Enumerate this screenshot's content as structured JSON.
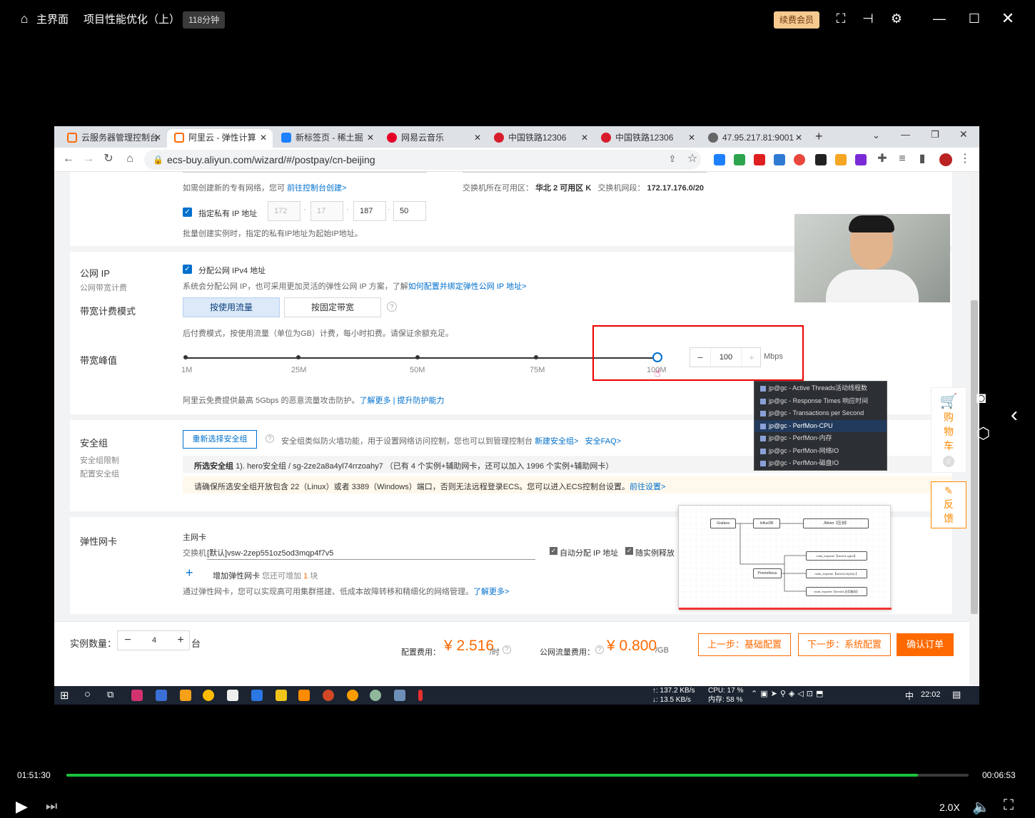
{
  "player": {
    "home_label": "主界面",
    "course_title": "项目性能优化（上）",
    "duration_badge": "118分钟",
    "vip_button": "续费会员",
    "time_elapsed": "01:51:30",
    "time_remaining": "00:06:53",
    "speed": "2.0X",
    "progress": 0.944
  },
  "browser": {
    "tabs": [
      {
        "title": "云服务器管理控制台",
        "color": "#ff6a00"
      },
      {
        "title": "阿里云 - 弹性计算",
        "color": "#ff6a00"
      },
      {
        "title": "新标签页 - 稀土掘",
        "color": "#1e80ff"
      },
      {
        "title": "网易云音乐",
        "color": "#e60026"
      },
      {
        "title": "中国铁路12306",
        "color": "#d71d2b"
      },
      {
        "title": "中国铁路12306",
        "color": "#d71d2b"
      },
      {
        "title": "47.95.217.81:9001",
        "color": "#666666"
      }
    ],
    "url": "ecs-buy.aliyun.com/wizard/#/postpay/cn-beijing"
  },
  "network": {
    "vpc_hint": "如需创建新的专有网络，您可",
    "vpc_hint_link": "前往控制台创建>",
    "zone_label": "交换机所在可用区：",
    "zone_value": "华北 2 可用区 K",
    "cidr_label": "交换机网段：",
    "cidr_value": "172.17.176.0/20",
    "private_ip_label": "指定私有 IP 地址",
    "ip_octets": [
      "172",
      "17",
      "187",
      "50"
    ],
    "private_ip_hint": "批量创建实例时，指定的私有IP地址为起始IP地址。"
  },
  "public_ip": {
    "title": "公网 IP",
    "subtitle": "公网带宽计费",
    "assign_label": "分配公网 IPv4 地址",
    "desc": "系统会分配公网 IP，也可采用更加灵活的弹性公网 IP 方案，了解",
    "desc_link": "如何配置并绑定弹性公网 IP 地址>",
    "billing_mode_label": "带宽计费模式",
    "mode_traffic": "按使用流量",
    "mode_fixed": "按固定带宽",
    "billing_hint": "后付费模式，按使用流量（单位为GB）计费，每小时扣费。请保证余额充足。",
    "bandwidth_label": "带宽峰值",
    "slider_ticks": [
      "1M",
      "25M",
      "50M",
      "75M",
      "100M"
    ],
    "bandwidth_value": "100",
    "bandwidth_unit": "Mbps",
    "ddos_hint": "阿里云免费提供最高 5Gbps 的恶意流量攻击防护。",
    "ddos_link1": "了解更多",
    "ddos_sep": "|",
    "ddos_link2": "提升防护能力"
  },
  "security_group": {
    "title": "安全组",
    "sub1": "安全组限制",
    "sub2": "配置安全组",
    "reselect_button": "重新选择安全组",
    "desc": "安全组类似防火墙功能，用于设置网络访问控制，您也可以到管理控制台",
    "link_new": "新建安全组>",
    "link_faq": "安全FAQ>",
    "selected_label": "所选安全组",
    "selected_value": "1). hero安全组 / sg-2ze2a8a4yl74rrzoahy7 （已有 4 个实例+辅助网卡，还可以加入 1996 个实例+辅助网卡）",
    "warning": "请确保所选安全组开放包含 22（Linux）或者 3389（Windows）端口，否则无法远程登录ECS。您可以进入ECS控制台设置。",
    "warning_link": "前往设置>"
  },
  "nic": {
    "title": "弹性网卡",
    "primary_label": "主网卡",
    "switch_label": "交换机",
    "switch_value": "[默认]vsw-2zep551oz5od3mqp4f7v5",
    "auto_ip_label": "自动分配 IP 地址",
    "release_label": "随实例释放",
    "add_label": "增加弹性网卡",
    "add_hint_prefix": "您还可增加",
    "add_hint_count": "1",
    "add_hint_suffix": "块",
    "desc": "通过弹性网卡，您可以实现高可用集群搭建、低成本故障转移和精细化的网络管理。",
    "desc_link": "了解更多>"
  },
  "order": {
    "qty_label": "实例数量：",
    "qty_value": "4",
    "qty_unit": "台",
    "config_fee_label": "配置费用：",
    "config_fee": "¥ 2.516",
    "config_fee_unit": "/时",
    "traffic_fee_label": "公网流量费用：",
    "traffic_fee": "¥ 0.800",
    "traffic_fee_unit": "/GB",
    "prev_button": "上一步：基础配置",
    "next_button": "下一步：系统配置",
    "confirm_button": "确认订单"
  },
  "side_tools": {
    "cart": [
      "购",
      "物",
      "车"
    ],
    "cart_count": "0",
    "feedback": [
      "反",
      "馈"
    ]
  },
  "jmeter_dropdown": [
    {
      "label": "jp@gc - Active Threads活动线程数",
      "selected": false
    },
    {
      "label": "jp@gc - Response Times 响应时间",
      "selected": false
    },
    {
      "label": "jp@gc - Transactions per Second",
      "selected": false
    },
    {
      "label": "jp@gc - PerfMon-CPU",
      "selected": true
    },
    {
      "label": "jp@gc - PerfMon-内存",
      "selected": false
    },
    {
      "label": "jp@gc - PerfMon-网络IO",
      "selected": false
    },
    {
      "label": "jp@gc - PerfMon-磁盘IO",
      "selected": false
    }
  ],
  "diagram": {
    "nodes": [
      "Grafana",
      "InfluxDB",
      "JMeter【压测】",
      "Prometheus",
      "node_exporter【hero01-nginx】",
      "node_exporter【hero02-MySQL】",
      "node_exporter【hero03-应用服务】"
    ]
  },
  "taskbar": {
    "net_up": "↑: 137.2 KB/s",
    "net_down": "↓: 13.5 KB/s",
    "cpu": "CPU: 17 %",
    "mem": "内存: 58 %",
    "ime": "中",
    "clock": "22:02"
  }
}
